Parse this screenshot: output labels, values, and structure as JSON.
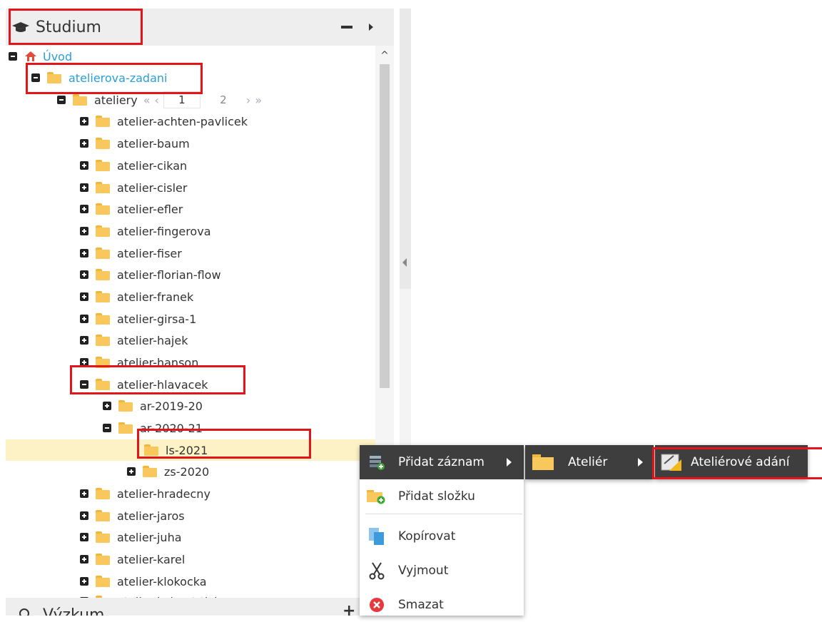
{
  "panel": {
    "title": "Studium",
    "title_icon": "graduation-cap-icon",
    "minimize_icon": "minus-icon",
    "expand_icon": "caret-right-icon"
  },
  "tree": {
    "root_label": "Úvod",
    "zadani_label": "atelierova-zadani",
    "ateliery_label": "ateliery",
    "pager": {
      "page1": "1",
      "page2": "2"
    },
    "ateliers": [
      "atelier-achten-pavlicek",
      "atelier-baum",
      "atelier-cikan",
      "atelier-cisler",
      "atelier-efler",
      "atelier-fingerova",
      "atelier-fiser",
      "atelier-florian-flow",
      "atelier-franek",
      "atelier-girsa-1",
      "atelier-hajek",
      "atelier-hanson",
      "atelier-hlavacek"
    ],
    "hlavacek_children": {
      "ar1": "ar-2019-20",
      "ar2": "ar-2020-21",
      "ls": "ls-2021",
      "zs": "zs-2020"
    },
    "after": [
      "atelier-hradecny",
      "atelier-jaros",
      "atelier-juha",
      "atelier-karel",
      "atelier-klokocka",
      "atelier-kohout-tichy"
    ]
  },
  "next_panel": {
    "title": "Výzkum"
  },
  "context_menu": {
    "items": [
      {
        "label": "Přidat záznam",
        "icon": "add-record-icon"
      },
      {
        "label": "Přidat složku",
        "icon": "add-folder-icon"
      },
      {
        "label": "Kopírovat",
        "icon": "copy-icon"
      },
      {
        "label": "Vyjmout",
        "icon": "scissors-icon"
      },
      {
        "label": "Smazat",
        "icon": "delete-icon"
      }
    ],
    "submenu1": {
      "label": "Ateliér",
      "icon": "folder-icon"
    },
    "submenu2": {
      "label": "Ateliérové adání",
      "icon": "assignment-icon"
    }
  },
  "colors": {
    "highlight": "#e3151a",
    "link": "#2a9fd6",
    "selected_row": "#fdf2c6",
    "folder": "#f8c85c",
    "menu_dark": "#3e3e3e"
  }
}
